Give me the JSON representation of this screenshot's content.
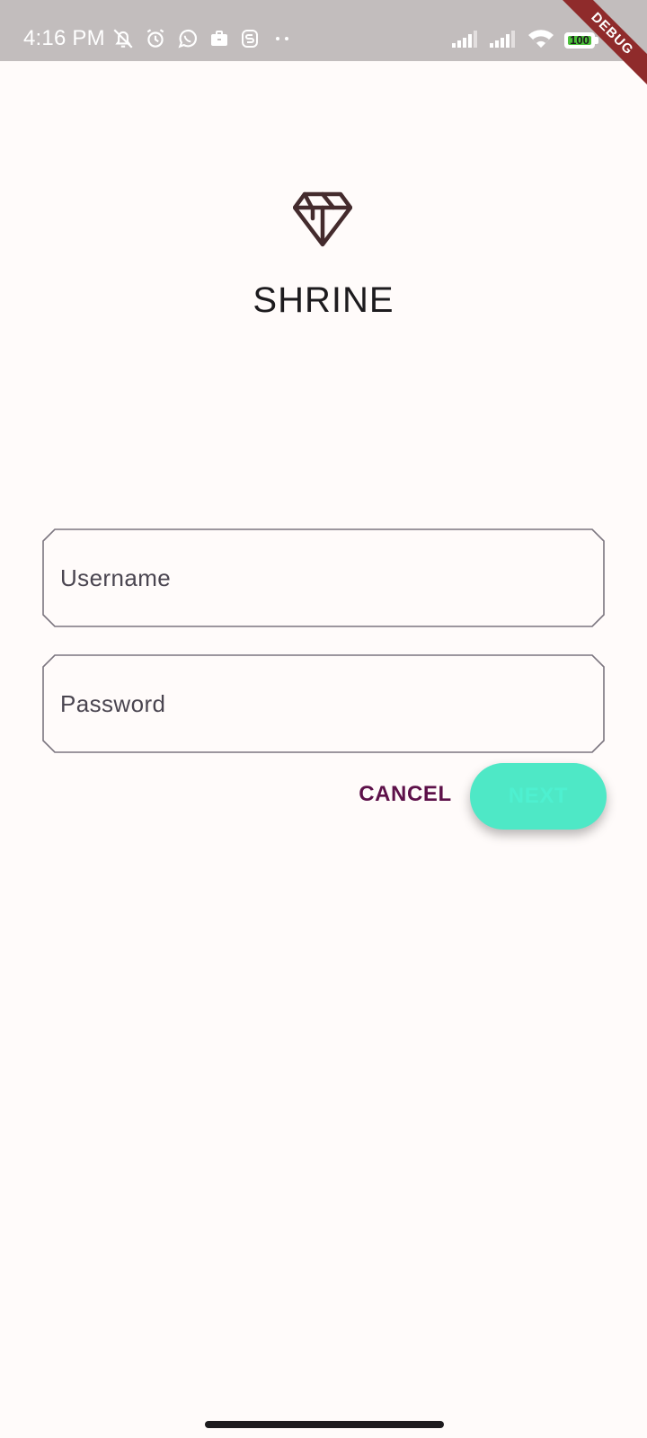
{
  "status_bar": {
    "time": "4:16 PM",
    "battery_level": "100",
    "battery_fraction": 1.0,
    "icons_left": [
      "notifications-off-icon",
      "alarm-icon",
      "whatsapp-icon",
      "briefcase-icon",
      "s-app-icon",
      "more-dots-icon"
    ],
    "icons_right": [
      "signal-icon",
      "signal-icon",
      "wifi-icon",
      "battery-icon"
    ]
  },
  "debug_banner": "DEBUG",
  "app": {
    "logo_icon": "diamond-icon",
    "title": "SHRINE"
  },
  "login_form": {
    "username_placeholder": "Username",
    "password_placeholder": "Password",
    "cancel_label": "CANCEL",
    "next_label": "NEXT"
  },
  "colors": {
    "background": "#fffbfa",
    "status_bar": "#c2bdbd",
    "accent_primary": "#5d1049",
    "next_button": "#4ee8c6",
    "logo": "#442b2d"
  }
}
